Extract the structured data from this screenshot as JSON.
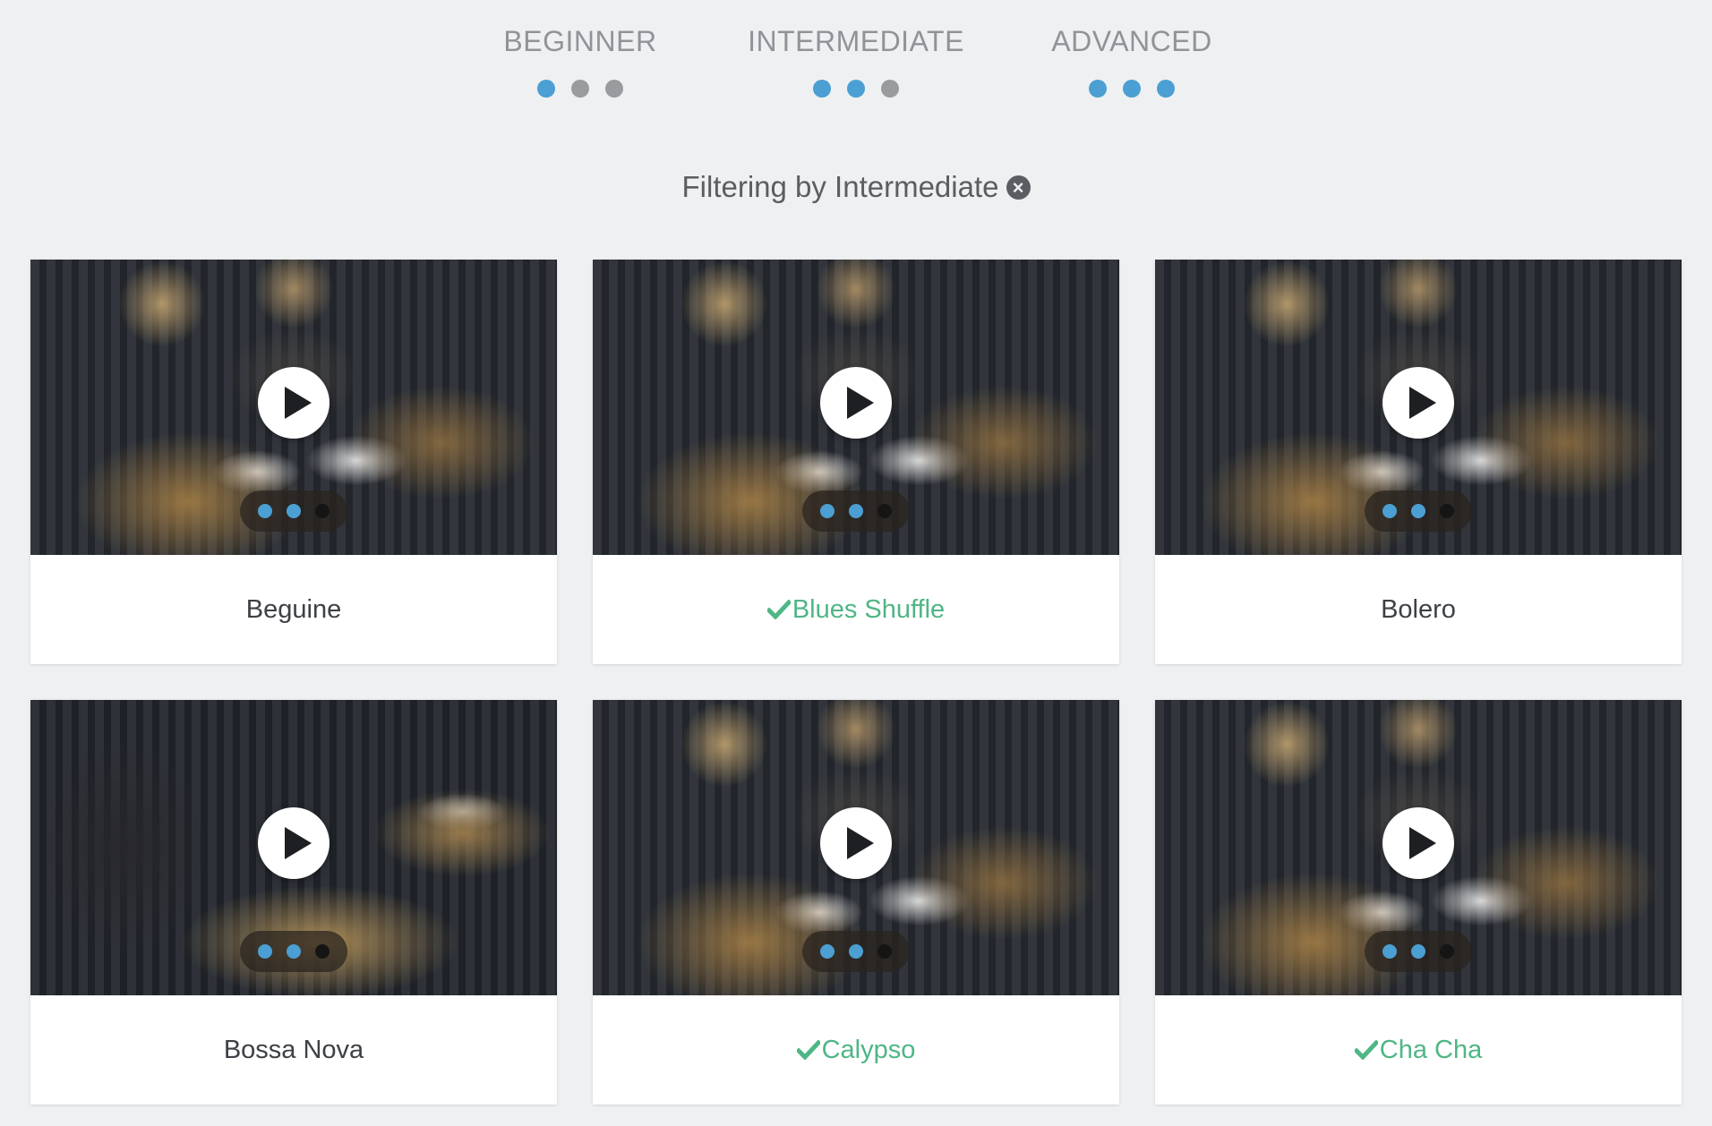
{
  "levels": [
    {
      "label": "BEGINNER",
      "dots": [
        true,
        false,
        false
      ]
    },
    {
      "label": "INTERMEDIATE",
      "dots": [
        true,
        true,
        false
      ]
    },
    {
      "label": "ADVANCED",
      "dots": [
        true,
        true,
        true
      ]
    }
  ],
  "filter": {
    "text": "Filtering by Intermediate",
    "clear_icon": "close-circle-icon"
  },
  "colors": {
    "background": "#eff0f2",
    "dot_active": "#4b9fd2",
    "dot_inactive": "#999b9e",
    "completed_green": "#4fb685",
    "title_text": "#3d4045"
  },
  "lessons": [
    {
      "title": "Beguine",
      "completed": false,
      "difficulty": [
        true,
        true,
        false
      ]
    },
    {
      "title": "Blues Shuffle",
      "completed": true,
      "difficulty": [
        true,
        true,
        false
      ]
    },
    {
      "title": "Bolero",
      "completed": false,
      "difficulty": [
        true,
        true,
        false
      ]
    },
    {
      "title": "Bossa Nova",
      "completed": false,
      "difficulty": [
        true,
        true,
        false
      ]
    },
    {
      "title": "Calypso",
      "completed": true,
      "difficulty": [
        true,
        true,
        false
      ]
    },
    {
      "title": "Cha Cha",
      "completed": true,
      "difficulty": [
        true,
        true,
        false
      ]
    }
  ]
}
